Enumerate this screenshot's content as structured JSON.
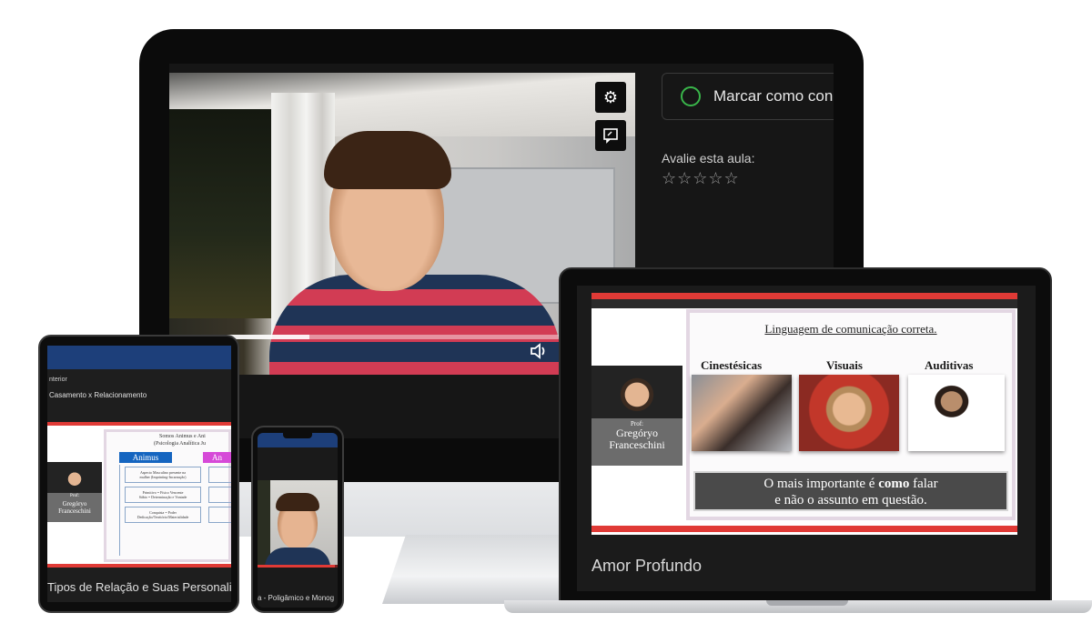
{
  "monitor": {
    "controls": {
      "settings_icon": "gear-icon",
      "feedback_icon": "chat-icon",
      "volume_icon": "volume-icon"
    },
    "video": {
      "progress": 0.3
    },
    "sidebar": {
      "complete_label": "Marcar como conc",
      "rate_label": "Avalie esta aula:",
      "stars": "☆☆☆☆☆",
      "rating": 0
    }
  },
  "laptop": {
    "slide": {
      "title": "Linguagem de comunicação correta.",
      "columns": [
        "Cinestésicas",
        "Visuais",
        "Auditivas"
      ],
      "caption_line1_a": "O mais importante é ",
      "caption_line1_bold": "como",
      "caption_line1_b": " falar",
      "caption_line2": "e não o assunto em questão.",
      "prof_label": "Prof:",
      "prof_name_1": "Gregóryo",
      "prof_name_2": "Franceschini"
    },
    "lesson_title": "Amor Profundo"
  },
  "tablet": {
    "nav_label": "nterior",
    "lesson_item": "Casamento x Relacionamento",
    "slide": {
      "title_1": "Somos Animus e Ani",
      "title_2": "(Psicologia Analítica Ju",
      "box_animus": "Animus",
      "box_anima": "An",
      "line_1": "Aspecto Masculino presente na",
      "line_2": "mulher (Imprinting-Incarnação)",
      "line_3": "Primitivo = Físico Vencente",
      "line_4": "Sábio = Determinação e Vontade",
      "line_5": "Conquista = Poder",
      "line_6": "Dedicação/Território/Materialidade",
      "prof_label": "Prof:",
      "prof_name_1": "Gregóryo",
      "prof_name_2": "Franceschini"
    },
    "lesson_title": "Tipos de Relação e Suas Personalid"
  },
  "phone": {
    "video": {
      "progress": 0.97
    },
    "lesson_title": "a - Poligâmico e Monog"
  },
  "colors": {
    "accent_red": "#e03a36",
    "header_blue": "#1d3f7a",
    "complete_green": "#39b54a"
  }
}
